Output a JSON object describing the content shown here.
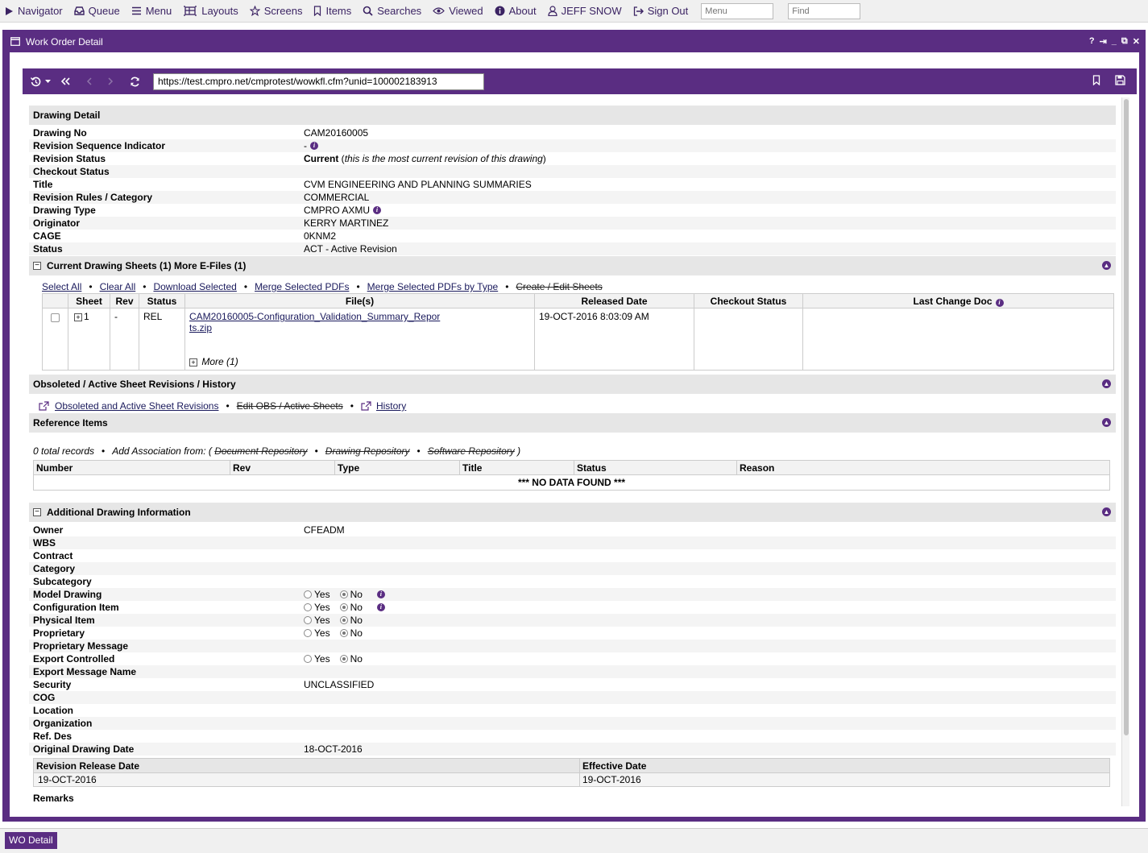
{
  "nav": {
    "items": [
      {
        "label": "Navigator",
        "icon": "play-icon"
      },
      {
        "label": "Queue",
        "icon": "inbox-icon"
      },
      {
        "label": "Menu",
        "icon": "hamburger-icon"
      },
      {
        "label": "Layouts",
        "icon": "layouts-icon"
      },
      {
        "label": "Screens",
        "icon": "star-icon"
      },
      {
        "label": "Items",
        "icon": "bookmark-icon"
      },
      {
        "label": "Searches",
        "icon": "search-icon"
      },
      {
        "label": "Viewed",
        "icon": "eye-icon"
      },
      {
        "label": "About",
        "icon": "info-icon"
      },
      {
        "label": "JEFF SNOW",
        "icon": "user-icon"
      },
      {
        "label": "Sign Out",
        "icon": "sign-out-icon"
      }
    ],
    "menu_placeholder": "Menu",
    "find_placeholder": "Find"
  },
  "window": {
    "title": "Work Order Detail",
    "controls": [
      "?",
      "⇥",
      "_",
      "⧉",
      "✕"
    ]
  },
  "browser": {
    "url": "https://test.cmpro.net/cmprotest/wowkfl.cfm?unid=100002183913"
  },
  "drawing_detail": {
    "header": "Drawing Detail",
    "fields": [
      {
        "label": "Drawing No",
        "value": "CAM20160005"
      },
      {
        "label": "Revision Sequence Indicator",
        "value": "-",
        "info": true
      },
      {
        "label": "Revision Status",
        "value_bold": "Current",
        "value_italic": "this is the most current revision of this drawing"
      },
      {
        "label": "Checkout Status",
        "value": ""
      },
      {
        "label": "Title",
        "value": "CVM ENGINEERING AND PLANNING SUMMARIES"
      },
      {
        "label": "Revision Rules / Category",
        "value": "COMMERCIAL"
      },
      {
        "label": "Drawing Type",
        "value": "CMPRO AXMU",
        "info": true
      },
      {
        "label": "Originator",
        "value": "KERRY MARTINEZ"
      },
      {
        "label": "CAGE",
        "value": "0KNM2"
      },
      {
        "label": "Status",
        "value": "ACT - Active Revision"
      }
    ]
  },
  "sheets": {
    "header": "Current Drawing Sheets (1) More E-Files (1)",
    "actions": [
      {
        "label": "Select All",
        "enabled": true
      },
      {
        "label": "Clear All",
        "enabled": true
      },
      {
        "label": "Download Selected",
        "enabled": true
      },
      {
        "label": "Merge Selected PDFs",
        "enabled": true
      },
      {
        "label": "Merge Selected PDFs by Type",
        "enabled": true
      },
      {
        "label": "Create / Edit Sheets",
        "enabled": false
      }
    ],
    "columns": [
      "",
      "Sheet",
      "Rev",
      "Status",
      "File(s)",
      "Released Date",
      "Checkout Status",
      "Last Change Doc"
    ],
    "rows": [
      {
        "sheet": "1",
        "rev": "-",
        "status": "REL",
        "file_line1": "CAM20160005-Configuration_Validation_Summary_Repor",
        "file_line2": "ts.zip",
        "more": "More (1)",
        "released": "19-OCT-2016 8:03:09 AM",
        "checkout": "",
        "last_change": ""
      }
    ]
  },
  "obsoleted": {
    "header": "Obsoleted / Active Sheet Revisions / History",
    "link1": "Obsoleted and Active Sheet Revisions",
    "link2": "Edit OBS / Active Sheets",
    "link3": "History"
  },
  "reference": {
    "header": "Reference Items",
    "total": "0 total records",
    "add_from": "Add Association from: (",
    "close_paren": ")",
    "sources": [
      "Document Repository",
      "Drawing Repository",
      "Software Repository"
    ],
    "columns": [
      "Number",
      "Rev",
      "Type",
      "Title",
      "Status",
      "Reason"
    ],
    "empty": "*** NO DATA FOUND ***"
  },
  "additional": {
    "header": "Additional Drawing Information",
    "yes": "Yes",
    "no": "No",
    "fields": [
      {
        "label": "Owner",
        "value": "CFEADM"
      },
      {
        "label": "WBS",
        "value": ""
      },
      {
        "label": "Contract",
        "value": ""
      },
      {
        "label": "Category",
        "value": ""
      },
      {
        "label": "Subcategory",
        "value": ""
      },
      {
        "label": "Model Drawing",
        "radio": "No",
        "info": true
      },
      {
        "label": "Configuration Item",
        "radio": "No",
        "info": true
      },
      {
        "label": "Physical Item",
        "radio": "No"
      },
      {
        "label": "Proprietary",
        "radio": "No"
      },
      {
        "label": "Proprietary Message",
        "value": ""
      },
      {
        "label": "Export Controlled",
        "radio": "No"
      },
      {
        "label": "Export Message Name",
        "value": ""
      },
      {
        "label": "Security",
        "value": "UNCLASSIFIED"
      },
      {
        "label": "COG",
        "value": ""
      },
      {
        "label": "Location",
        "value": ""
      },
      {
        "label": "Organization",
        "value": ""
      },
      {
        "label": "Ref. Des",
        "value": ""
      },
      {
        "label": "Original Drawing Date",
        "value": "18-OCT-2016"
      }
    ],
    "release_table": {
      "col1": "Revision Release Date",
      "col2": "Effective Date",
      "val1": "19-OCT-2016",
      "val2": "19-OCT-2016"
    },
    "remarks_label": "Remarks"
  },
  "taskbar": {
    "tab": "WO Detail"
  },
  "colors": {
    "brand": "#5a2d82"
  }
}
